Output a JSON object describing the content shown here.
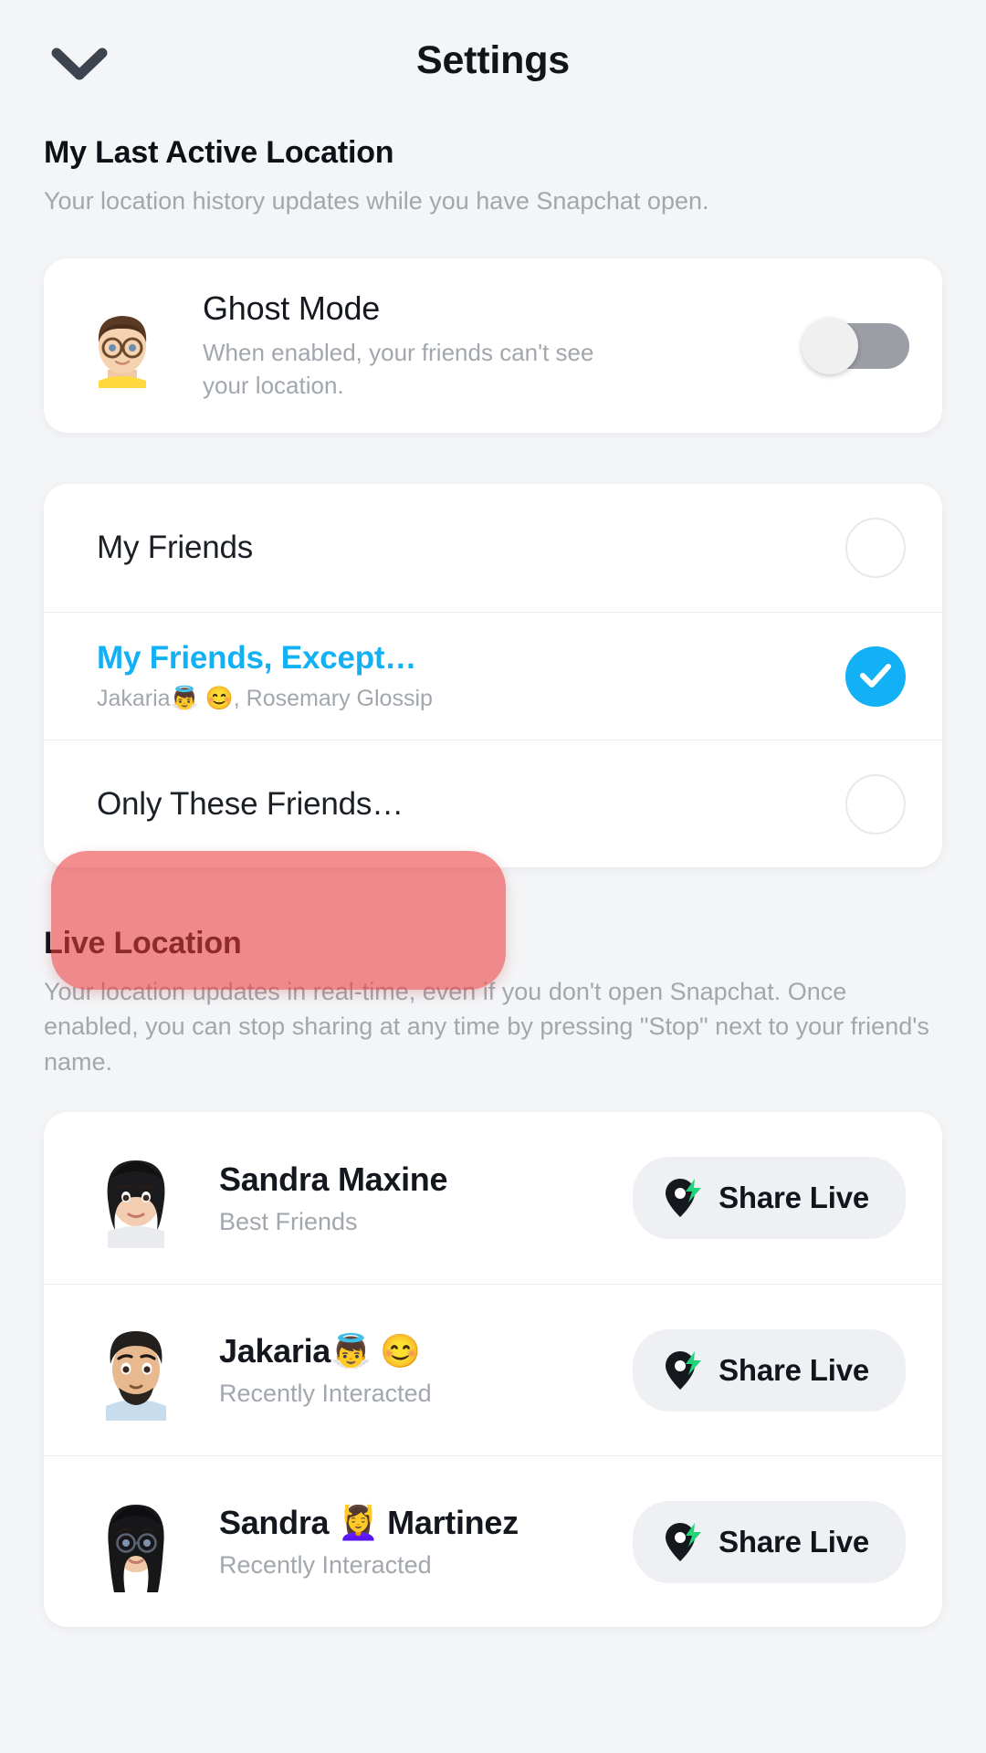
{
  "header": {
    "title": "Settings",
    "back_icon": "chevron-down-icon"
  },
  "sections": {
    "last_active": {
      "title": "My Last Active Location",
      "description": "Your location history updates while you have Snapchat open."
    },
    "live_location": {
      "title": "Live Location",
      "description": "Your location updates in real-time, even if you don't open Snapchat. Once enabled, you can stop sharing at any time by pressing \"Stop\" next to your friend's name."
    }
  },
  "ghost_mode": {
    "title": "Ghost Mode",
    "description": "When enabled, your friends can't see your location.",
    "toggle_state": "off",
    "avatar": "bitmoji-glasses-yellow-shirt"
  },
  "audience_options": [
    {
      "label": "My Friends",
      "subtitle": "",
      "selected": false
    },
    {
      "label": "My Friends, Except…",
      "subtitle": "Jakaria👼 😊, Rosemary Glossip",
      "selected": true
    },
    {
      "label": "Only These Friends…",
      "subtitle": "",
      "selected": false
    }
  ],
  "friends": [
    {
      "name": "Sandra Maxine",
      "status": "Best Friends",
      "action_label": "Share Live",
      "avatar": "bitmoji-black-bob-hair"
    },
    {
      "name": "Jakaria👼 😊",
      "status": "Recently Interacted",
      "action_label": "Share Live",
      "avatar": "bitmoji-beard-blue-shirt"
    },
    {
      "name": "Sandra 💆‍♀️ Martinez",
      "status": "Recently Interacted",
      "action_label": "Share Live",
      "avatar": "bitmoji-long-hair-glasses"
    }
  ],
  "annotation": {
    "type": "red-highlight-box",
    "targets": "Only These Friends…",
    "color": "#ea3c3c"
  },
  "colors": {
    "background": "#f4f5f7",
    "card": "#ffffff",
    "accent_blue": "#12b0f4",
    "muted_text": "#a2a7ae",
    "primary_text": "#14181e",
    "toggle_track_off": "#9b9ea4",
    "button_fill": "#eef0f3",
    "bolt_green": "#22d37a"
  }
}
